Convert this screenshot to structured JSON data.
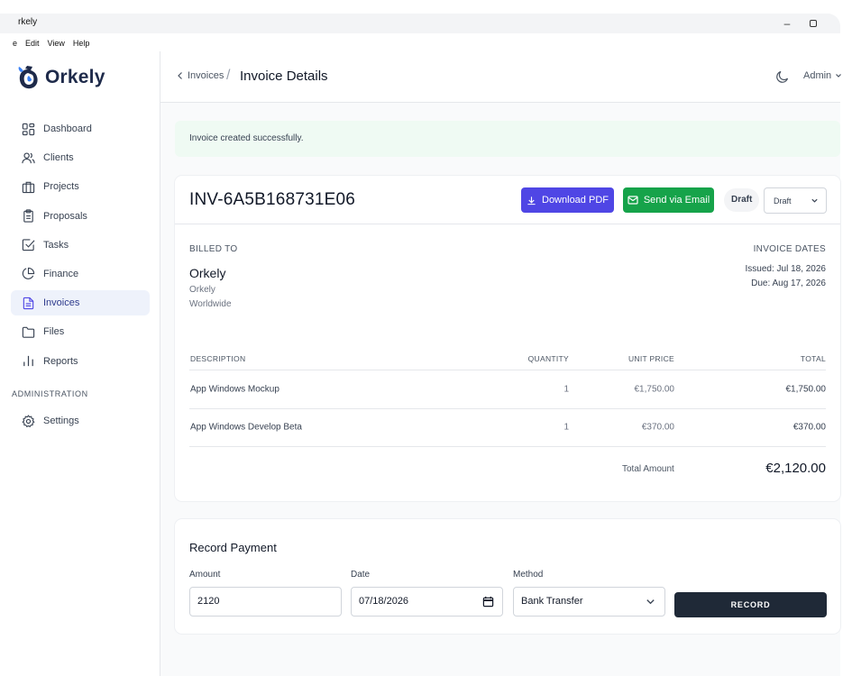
{
  "window": {
    "title": "Orkely",
    "title_visible": "rkely",
    "minimize_label": "–"
  },
  "menu": [
    "e",
    "Edit",
    "View",
    "Help"
  ],
  "sidebar": {
    "logo_text": "Orkely",
    "items": [
      {
        "label": "Dashboard",
        "icon": "dashboard-icon"
      },
      {
        "label": "Clients",
        "icon": "users-icon"
      },
      {
        "label": "Projects",
        "icon": "briefcase-icon"
      },
      {
        "label": "Proposals",
        "icon": "clipboard-icon"
      },
      {
        "label": "Tasks",
        "icon": "check-square-icon"
      },
      {
        "label": "Finance",
        "icon": "pie-chart-icon"
      },
      {
        "label": "Invoices",
        "icon": "file-text-icon",
        "active": true
      },
      {
        "label": "Files",
        "icon": "folder-icon"
      },
      {
        "label": "Reports",
        "icon": "bar-chart-icon"
      }
    ],
    "admin_section": "ADMINISTRATION",
    "settings_label": "Settings"
  },
  "header": {
    "back_label": "Invoices",
    "separator": "/",
    "title": "Invoice Details",
    "user": "Admin"
  },
  "alert": {
    "text": "Invoice created successfully."
  },
  "invoice": {
    "number": "INV-6A5B168731E06",
    "download_label": "Download PDF",
    "email_label": "Send via Email",
    "status_badge": "Draft",
    "status_select": "Draft",
    "billed_to_label": "BILLED TO",
    "client_name": "Orkely",
    "client_line1": "Orkely",
    "client_line2": "Worldwide",
    "dates_label": "INVOICE DATES",
    "issued": "Issued: Jul 18, 2026",
    "due": "Due: Aug 17, 2026",
    "columns": {
      "description": "DESCRIPTION",
      "quantity": "QUANTITY",
      "unit_price": "UNIT PRICE",
      "total": "TOTAL"
    },
    "rows": [
      {
        "description": "App Windows Mockup",
        "quantity": "1",
        "unit_price": "€1,750.00",
        "total": "€1,750.00"
      },
      {
        "description": "App Windows Develop Beta",
        "quantity": "1",
        "unit_price": "€370.00",
        "total": "€370.00"
      }
    ],
    "total_label": "Total Amount",
    "total_amount": "€2,120.00"
  },
  "payment": {
    "title": "Record Payment",
    "amount_label": "Amount",
    "amount_value": "2120",
    "date_label": "Date",
    "date_value": "07/18/2026",
    "method_label": "Method",
    "method_value": "Bank Transfer",
    "record_label": "RECORD"
  },
  "colors": {
    "primary": "#4f46e5",
    "success": "#16a34a",
    "dark": "#1f2937",
    "alert_bg": "#effaf3",
    "active_nav_bg": "#eef2fb"
  }
}
